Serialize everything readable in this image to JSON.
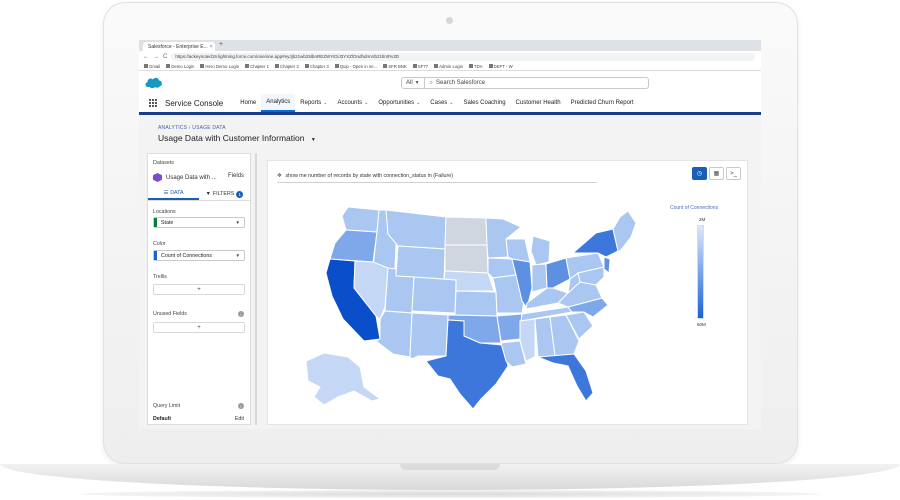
{
  "browser": {
    "tab_title": "Salesforce - Enterprise E...",
    "tab_close": "×",
    "new_tab": "+",
    "nav_back": "←",
    "nav_forward": "→",
    "nav_reload": "C",
    "url": "https://ackeynoted19.lightning.force.com/one/one.app#eyJjb21wb25lbnREZWYiOiJ3YXZlOndhdmVIb21lIn0%3D",
    "bookmarks": [
      "Gmail",
      "Demo Login",
      "Hero Demo Login",
      "Chapter 1",
      "Chapter 2",
      "Chapter 3",
      "Quip - Open in ne...",
      "SFR BNK",
      "SF77",
      "Admin Login",
      "TDA",
      "DEFT - W"
    ]
  },
  "header": {
    "search_scope": "All",
    "search_placeholder": "Search Salesforce"
  },
  "nav": {
    "app_name": "Service Console",
    "items": [
      {
        "label": "Home",
        "caret": false,
        "active": false
      },
      {
        "label": "Analytics",
        "caret": false,
        "active": true
      },
      {
        "label": "Reports",
        "caret": true,
        "active": false
      },
      {
        "label": "Accounts",
        "caret": true,
        "active": false
      },
      {
        "label": "Opportunities",
        "caret": true,
        "active": false
      },
      {
        "label": "Cases",
        "caret": true,
        "active": false
      },
      {
        "label": "Sales Coaching",
        "caret": false,
        "active": false
      },
      {
        "label": "Customer Health",
        "caret": false,
        "active": false
      },
      {
        "label": "Predicted Churn Report",
        "caret": false,
        "active": false
      }
    ]
  },
  "page": {
    "breadcrumb": "ANALYTICS › USAGE DATA",
    "title": "Usage Data with Customer Information",
    "title_caret": "▼"
  },
  "panel": {
    "datasets_label": "Datasets",
    "dataset_name": "Usage Data with ...",
    "fields_label": "Fields",
    "tab_data": "DATA",
    "tab_filters": "FILTERS",
    "filters_count": "1",
    "locations_label": "Locations",
    "locations_value": "State",
    "color_label": "Color",
    "color_value": "Count of Connections",
    "trellis_label": "Trellis",
    "plus": "+",
    "unused_label": "Unused Fields",
    "info": "i",
    "query_limit_label": "Query Limit",
    "query_limit_value": "Default",
    "edit_label": "Edit",
    "accents": {
      "locations": "#0e7a3f",
      "color": "#1a63d6"
    }
  },
  "canvas": {
    "query_text": "show me number of records by state with connection_status in (Failure)",
    "legend_title": "Count of Connections",
    "legend_max": "2M",
    "legend_min": "60M"
  },
  "map_colors": {
    "light_gray": "#cfd6e0",
    "pale": "#c4d8f5",
    "light": "#a9c7f1",
    "mid": "#7fa8ea",
    "medium": "#5d8fe2",
    "strong": "#3d77dc",
    "dark": "#1b5dd0",
    "darkest": "#0a4fc9"
  },
  "icons": {
    "cloud": "salesforce-cloud-logo",
    "waffle": "app-launcher-icon",
    "search": "search-icon",
    "gear": "query-icon",
    "chart_view": "chart-view-icon",
    "table_view": "table-view-icon",
    "sql_view": "sql-view-icon"
  }
}
